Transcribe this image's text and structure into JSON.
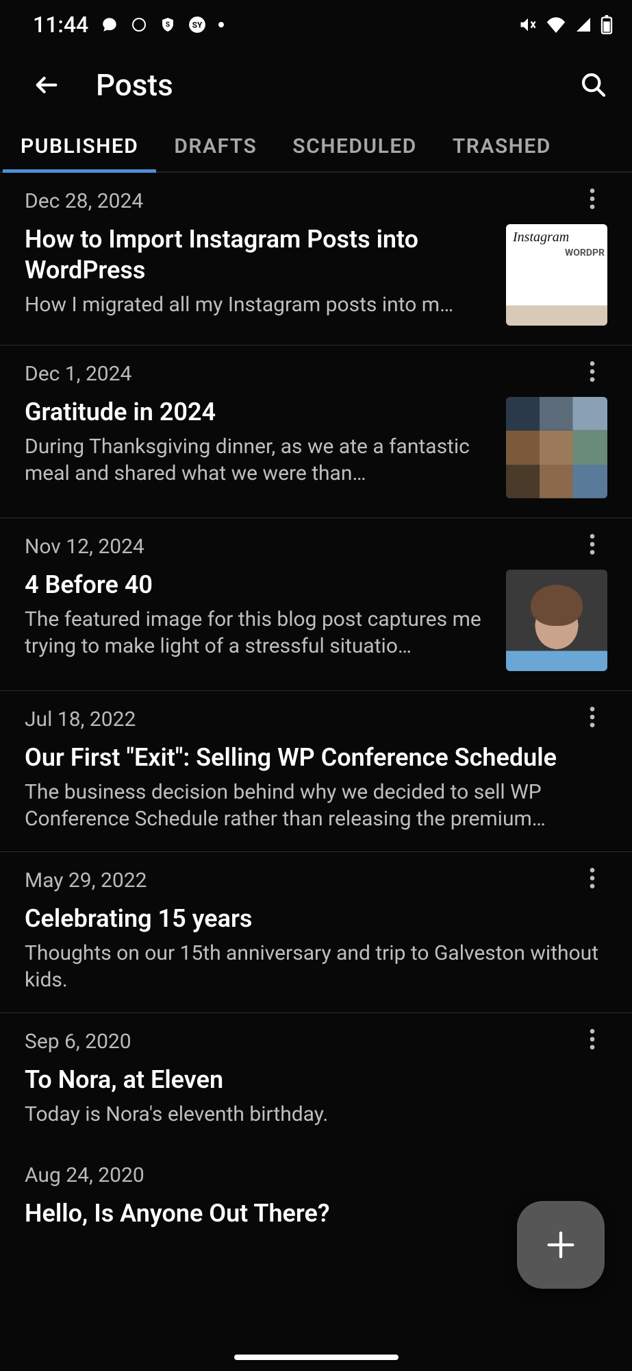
{
  "status": {
    "time": "11:44"
  },
  "header": {
    "title": "Posts"
  },
  "tabs": [
    {
      "label": "PUBLISHED",
      "active": true
    },
    {
      "label": "DRAFTS",
      "active": false
    },
    {
      "label": "SCHEDULED",
      "active": false
    },
    {
      "label": "TRASHED",
      "active": false
    }
  ],
  "posts": [
    {
      "date": "Dec 28, 2024",
      "title": "How to Import Instagram Posts into WordPress",
      "excerpt": "How I migrated all my Instagram posts into m…",
      "thumb": "ig"
    },
    {
      "date": "Dec 1, 2024",
      "title": "Gratitude in 2024",
      "excerpt": "During Thanksgiving dinner, as we ate a fantastic meal and shared what we were than…",
      "thumb": "grat"
    },
    {
      "date": "Nov 12, 2024",
      "title": "4 Before 40",
      "excerpt": "The featured image for this blog post captures me trying to make light of a stressful situatio…",
      "thumb": "4b40"
    },
    {
      "date": "Jul 18, 2022",
      "title": "Our First \"Exit\": Selling WP Conference Schedule",
      "excerpt": "The business decision behind why we decided to sell WP Conference Schedule rather than releasing the premium…",
      "thumb": null
    },
    {
      "date": "May 29, 2022",
      "title": "Celebrating 15 years",
      "excerpt": "Thoughts on our 15th anniversary and trip to Galveston without kids.",
      "thumb": null
    },
    {
      "date": "Sep 6, 2020",
      "title": "To Nora, at Eleven",
      "excerpt": "Today is Nora's eleventh birthday.",
      "thumb": null
    },
    {
      "date": "Aug 24, 2020",
      "title": "Hello, Is Anyone Out There?",
      "excerpt": "",
      "thumb": null
    }
  ]
}
